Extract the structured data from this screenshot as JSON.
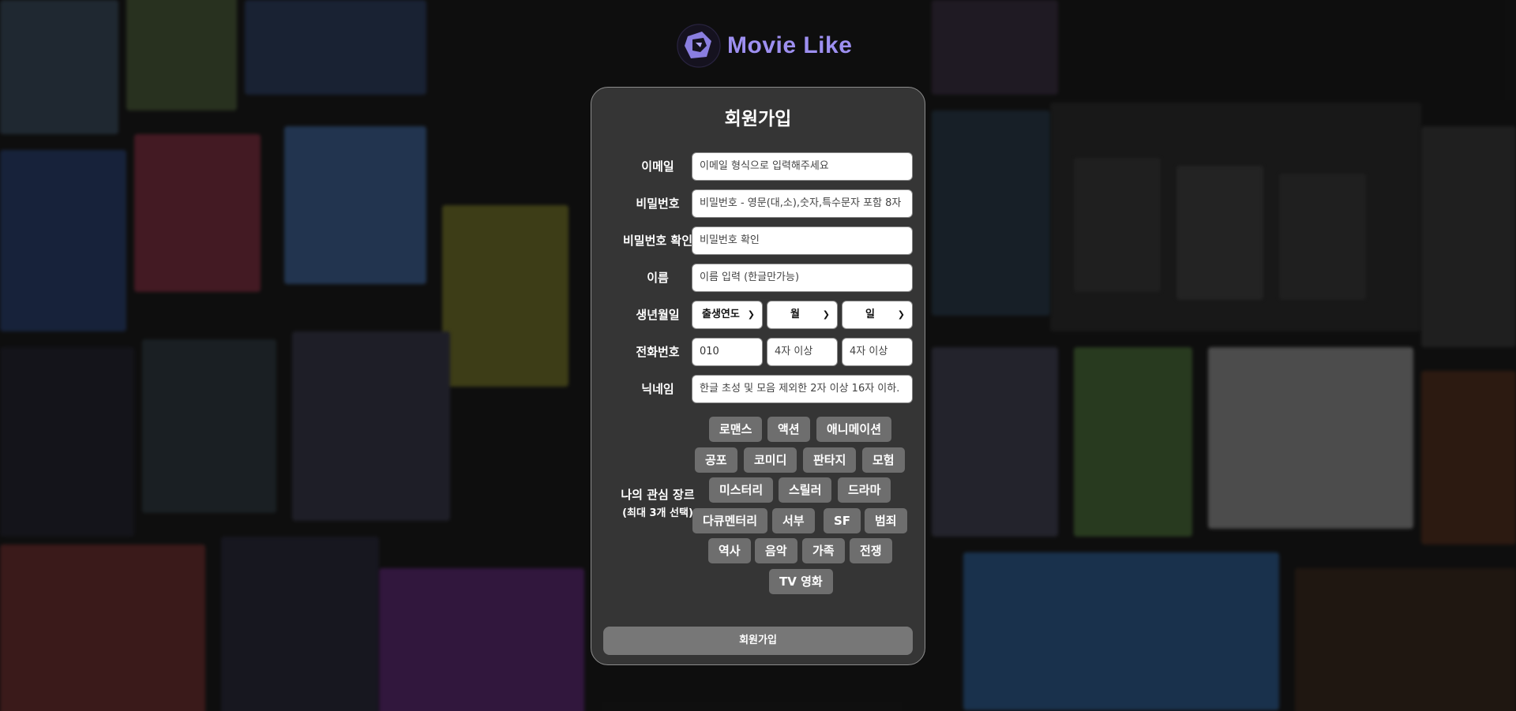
{
  "brand": {
    "name": "Movie Like",
    "color": "#9d8ff0"
  },
  "form": {
    "title": "회원가입",
    "email": {
      "label": "이메일",
      "placeholder": "이메일 형식으로 입력해주세요"
    },
    "password": {
      "label": "비밀번호",
      "placeholder": "비밀번호 - 영문(대,소),숫자,특수문자 포함 8자"
    },
    "password_confirm": {
      "label": "비밀번호 확인",
      "placeholder": "비밀번호 확인"
    },
    "name": {
      "label": "이름",
      "placeholder": "이름 입력 (한글만가능)"
    },
    "birth": {
      "label": "생년월일",
      "year": "출생연도",
      "month": "월",
      "day": "일"
    },
    "phone": {
      "label": "전화번호",
      "prefix": "010",
      "middle_placeholder": "4자 이상",
      "last_placeholder": "4자 이상"
    },
    "nickname": {
      "label": "닉네임",
      "placeholder": "한글 초성 및 모음 제외한 2자 이상 16자 이하."
    },
    "genres": {
      "label": "나의 관심 장르",
      "sublabel": "(최대 3개 선택)",
      "items": [
        "로맨스",
        "액션",
        "애니메이션",
        "공포",
        "코미디",
        "판타지",
        "모험",
        "미스터리",
        "스릴러",
        "드라마",
        "다큐멘터리",
        "서부",
        "SF",
        "범죄",
        "역사",
        "음악",
        "가족",
        "전쟁",
        "TV 영화"
      ]
    },
    "submit_label": "회원가입"
  },
  "colors": {
    "card_bg": "#353535",
    "chip_bg": "#6e6e6e",
    "submit_bg": "#777777"
  }
}
